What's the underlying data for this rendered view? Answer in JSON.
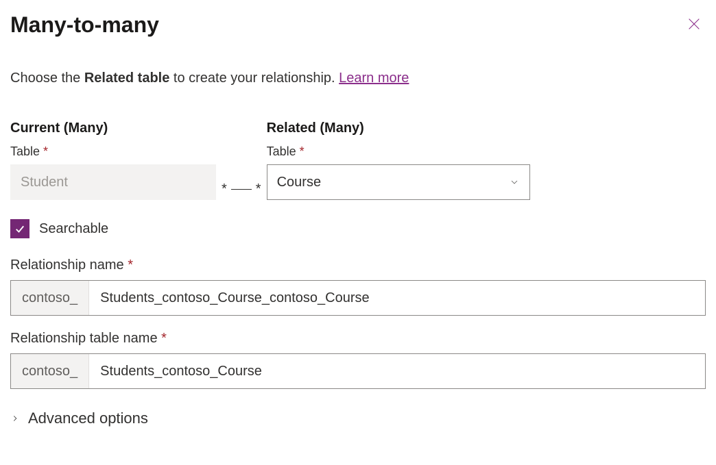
{
  "header": {
    "title": "Many-to-many"
  },
  "intro": {
    "prefix": "Choose the ",
    "bold": "Related table",
    "suffix": " to create your relationship. ",
    "link": "Learn more"
  },
  "current": {
    "heading": "Current (Many)",
    "label": "Table ",
    "value": "Student"
  },
  "related": {
    "heading": "Related (Many)",
    "label": "Table ",
    "value": "Course"
  },
  "connector": {
    "left": "*",
    "right": "*"
  },
  "searchable": {
    "label": "Searchable",
    "checked": true
  },
  "relationship_name": {
    "label": "Relationship name ",
    "prefix": "contoso_",
    "value": "Students_contoso_Course_contoso_Course"
  },
  "relationship_table_name": {
    "label": "Relationship table name ",
    "prefix": "contoso_",
    "value": "Students_contoso_Course"
  },
  "advanced": {
    "label": "Advanced options"
  },
  "required_marker": "*"
}
